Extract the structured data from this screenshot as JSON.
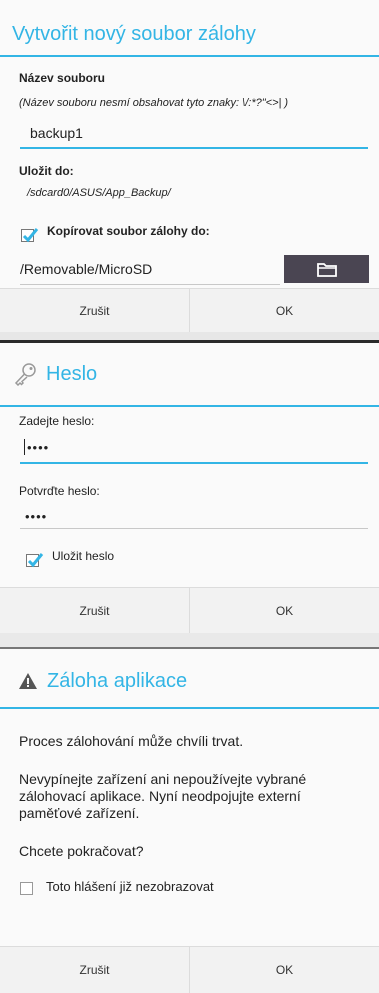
{
  "backup_dialog": {
    "title": "Vytvořit nový soubor zálohy",
    "filename_label": "Název souboru",
    "filename_hint": "(Název souboru nesmí obsahovat tyto znaky: \\/:*?\"<>| )",
    "filename_value": "backup1",
    "save_to_label": "Uložit do:",
    "save_to_path": "/sdcard0/ASUS/App_Backup/",
    "copy_checkbox_label": "Kopírovat soubor zálohy do:",
    "copy_checked": true,
    "copy_path_value": "/Removable/MicroSD",
    "folder_icon": "folder-icon",
    "cancel_label": "Zrušit",
    "ok_label": "OK"
  },
  "password_dialog": {
    "title": "Heslo",
    "key_icon": "key-icon",
    "enter_label": "Zadejte heslo:",
    "enter_value": "••••",
    "confirm_label": "Potvrďte heslo:",
    "confirm_value": "••••",
    "save_password_label": "Uložit heslo",
    "save_checked": true,
    "cancel_label": "Zrušit",
    "ok_label": "OK"
  },
  "app_backup_dialog": {
    "title": "Záloha aplikace",
    "warning_icon": "warning-icon",
    "paragraph1": "Proces zálohování může chvíli trvat.",
    "paragraph2_line1": "Nevypínejte zařízení ani nepoužívejte vybrané",
    "paragraph2_line2": "zálohovací aplikace. Nyní neodpojujte externí",
    "paragraph2_line3": "paměťové zařízení.",
    "question": "Chcete pokračovat?",
    "dont_show_label": "Toto hlášení již nezobrazovat",
    "dont_show_checked": false,
    "cancel_label": "Zrušit",
    "ok_label": "OK"
  },
  "colors": {
    "accent": "#33b5e5",
    "button_dark": "#4a4552"
  }
}
